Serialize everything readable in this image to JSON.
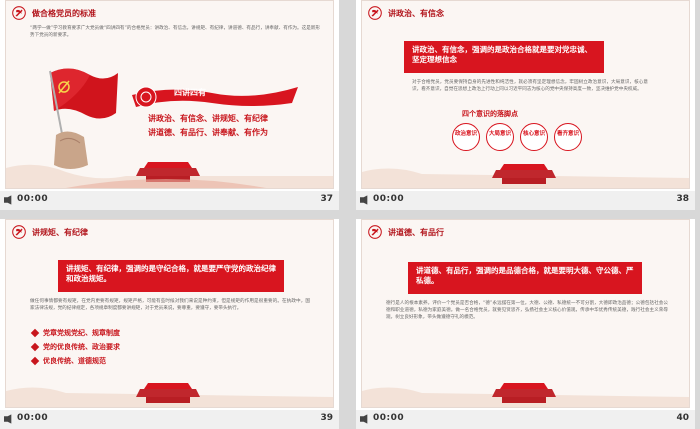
{
  "slides": [
    {
      "number": "37",
      "time": "00:00",
      "header": "做合格党员的标准",
      "intro": "“两学一做”学习教育要求广大党员做“四讲四有”的合格党员：讲政治、有信念，讲规矩、有纪律，讲道德、有品行，讲奉献、有作为。这是新形势下党员的新要求。",
      "banner": "四讲四有",
      "lines": [
        "讲政治、有信念、讲规矩、有纪律",
        "讲道德、有品行、讲奉献、有作为"
      ]
    },
    {
      "number": "38",
      "time": "00:00",
      "header": "讲政治、有信念",
      "box": "讲政治、有信念，强调的是政治合格就是要对党忠诚、坚定理想信念",
      "para": "对于合格党员，党员要保持自身的先进性和纯洁性，就必须有坚定理想信念，牢固树立政治意识，大局意识，核心意识，看齐意识，自觉在思想上政治上行动上同以习近平同志为核心的党中央保持高度一致，坚决维护党中央权威。",
      "subtitle": "四个意识的落脚点",
      "circles": [
        "政治意识",
        "大局意识",
        "核心意识",
        "看齐意识"
      ]
    },
    {
      "number": "39",
      "time": "00:00",
      "header": "讲规矩、有纪律",
      "box": "讲规矩、有纪律，强调的是守纪合格，就是要严守党的政治纪律和政治规矩。",
      "para": "做任何事情都要有规矩，在党内更要有规矩，规矩严格，可能有些时候对我们来说是种约束，但是规矩的作用是很重要的。在执政中，国家法律法规，党的纪律规定，各项规章制度都要讲规矩，对于党员来说，要尊重，要遵守，要带头执行。",
      "bullets": [
        "党章党规党纪、规章制度",
        "党的优良传统、政治要求",
        "优良传统、道德规范"
      ]
    },
    {
      "number": "40",
      "time": "00:00",
      "header": "讲道德、有品行",
      "box": "讲道德、有品行，强调的是品德合格，就是要明大德、守公德、严私德。",
      "para": "德行是人的根本素养。评价一个党员是否合格，“德”永远摆在第一位。大德、公德、私德统一不可分割，大德即政治品德；公德包括社会公德和职业道德，私德为家庭美德。做一名合格党员，就要见贤思齐，弘扬社会主义核心价值观，传承中华优秀传统美德，践行社会主义荣辱观，树立良好形象，带头做遵德守礼的模范。"
    }
  ]
}
